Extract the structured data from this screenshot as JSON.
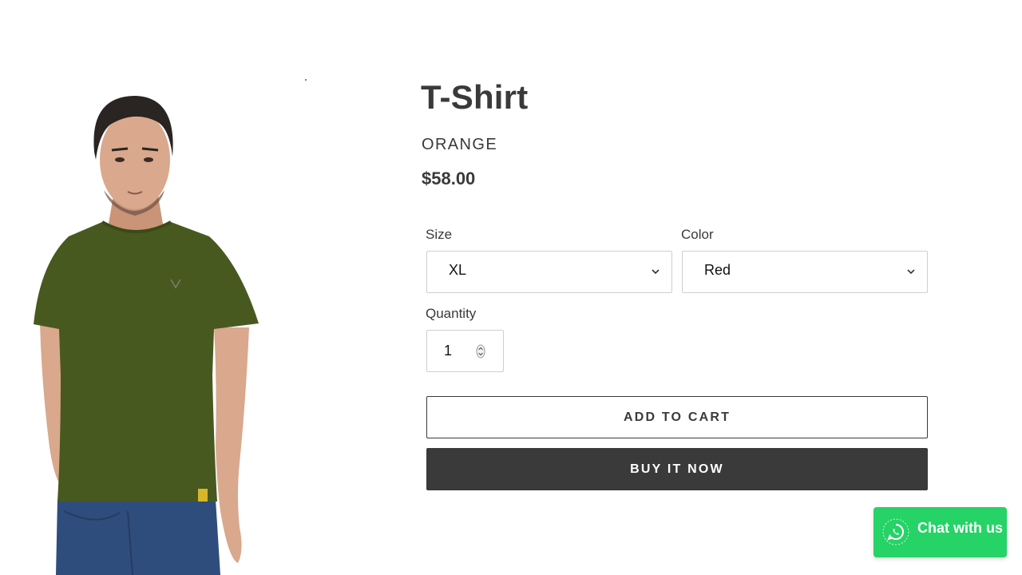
{
  "product": {
    "title": "T-Shirt",
    "vendor": "ORANGE",
    "price": "$58.00",
    "image_icon": "product-photo-man-olive-tshirt"
  },
  "options": {
    "size": {
      "label": "Size",
      "selected": "XL"
    },
    "color": {
      "label": "Color",
      "selected": "Red"
    }
  },
  "quantity": {
    "label": "Quantity",
    "value": "1"
  },
  "actions": {
    "add_to_cart": "ADD TO CART",
    "buy_now": "BUY IT NOW"
  },
  "chat": {
    "label": "Chat with us",
    "icon": "whatsapp-icon",
    "color": "#25d366"
  },
  "colors": {
    "text": "#3a3a3a",
    "primary_button": "#3a3a3a",
    "border": "#cfcfcf"
  }
}
